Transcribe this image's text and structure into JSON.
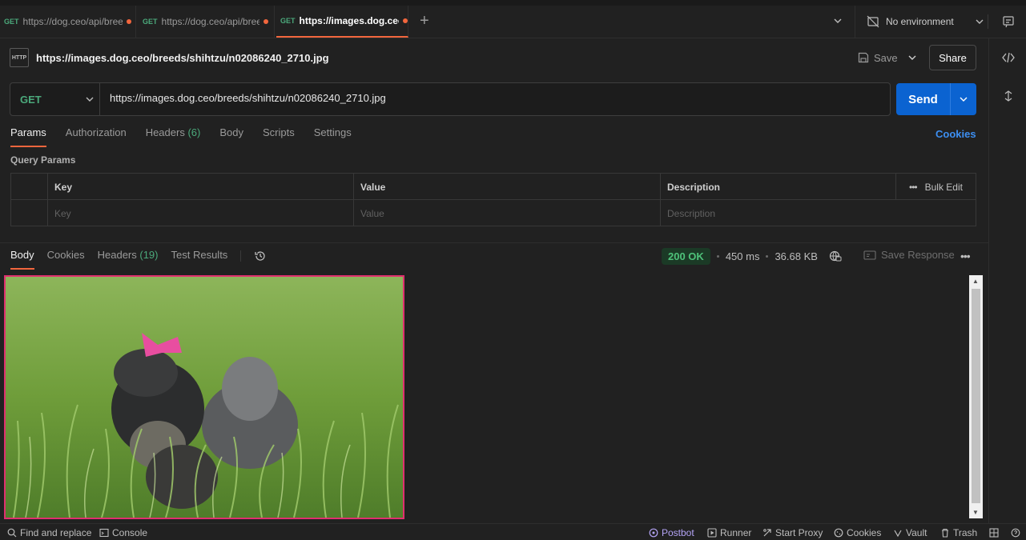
{
  "tabs": [
    {
      "method": "GET",
      "url": "https://dog.ceo/api/breeds",
      "unsaved": true,
      "active": false
    },
    {
      "method": "GET",
      "url": "https://dog.ceo/api/breeds",
      "unsaved": true,
      "active": false
    },
    {
      "method": "GET",
      "url": "https://images.dog.ceo/breeds",
      "unsaved": true,
      "active": true
    }
  ],
  "environment": {
    "label": "No environment"
  },
  "request": {
    "title": "https://images.dog.ceo/breeds/shihtzu/n02086240_2710.jpg",
    "http_badge": "HTTP",
    "method": "GET",
    "url": "https://images.dog.ceo/breeds/shihtzu/n02086240_2710.jpg",
    "save_label": "Save",
    "share_label": "Share",
    "send_label": "Send"
  },
  "request_tabs": {
    "params": "Params",
    "authorization": "Authorization",
    "headers": "Headers",
    "headers_count": "(6)",
    "body": "Body",
    "scripts": "Scripts",
    "settings": "Settings",
    "cookies": "Cookies"
  },
  "query_params": {
    "label": "Query Params",
    "columns": {
      "key": "Key",
      "value": "Value",
      "description": "Description"
    },
    "bulk_edit": "Bulk Edit",
    "placeholders": {
      "key": "Key",
      "value": "Value",
      "description": "Description"
    }
  },
  "response": {
    "tabs": {
      "body": "Body",
      "cookies": "Cookies",
      "headers": "Headers",
      "headers_count": "(19)",
      "test_results": "Test Results"
    },
    "status": "200 OK",
    "time": "450 ms",
    "size": "36.68 KB",
    "save_response": "Save Response"
  },
  "footer": {
    "find_replace": "Find and replace",
    "console": "Console",
    "postbot": "Postbot",
    "runner": "Runner",
    "start_proxy": "Start Proxy",
    "cookies": "Cookies",
    "vault": "Vault",
    "trash": "Trash"
  },
  "colors": {
    "accent": "#f2663d",
    "send_blue": "#0b63d1",
    "method_green": "#4ba97b",
    "link_blue": "#3d8ff2",
    "image_border": "#e0306f"
  }
}
